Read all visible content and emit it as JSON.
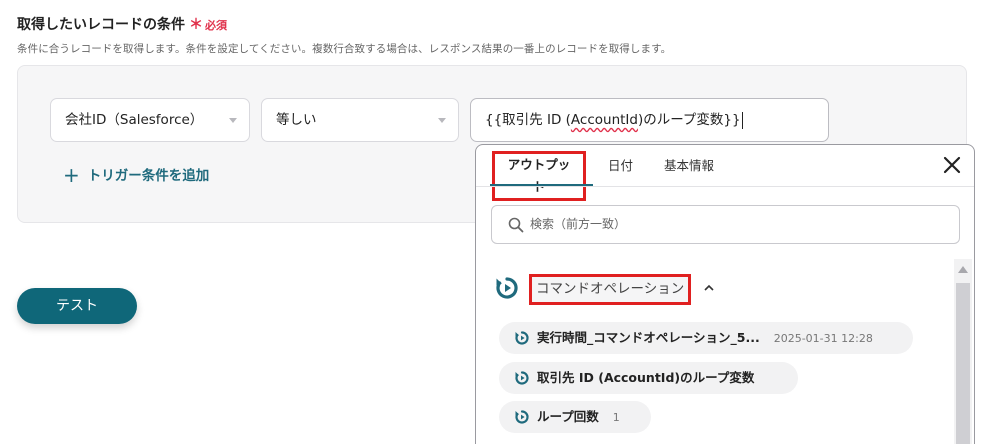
{
  "form": {
    "title": "取得したいレコードの条件",
    "required_mark": "＊",
    "required_text": "必須",
    "description": "条件に合うレコードを取得します。条件を設定してください。複数行合致する場合は、レスポンス結果の一番上のレコードを取得します。"
  },
  "condition": {
    "field_value": "会社ID（Salesforce）",
    "operator_value": "等しい",
    "value_prefix": "{{取引先 ID (",
    "value_wavy": "AccountId",
    "value_suffix": ")のループ変数}}"
  },
  "add_trigger_label": "トリガー条件を追加",
  "test_button_label": "テスト",
  "popup": {
    "tabs": [
      "アウトプット",
      "日付",
      "基本情報"
    ],
    "active_tab": "アウトプット",
    "search_placeholder": "検索（前方一致）",
    "group_label": "コマンドオペレーション",
    "items": [
      {
        "label": "実行時間_コマンドオペレーション_5...",
        "value": "2025-01-31 12:28"
      },
      {
        "label": "取引先 ID (AccountId)のループ変数",
        "value": ""
      },
      {
        "label": "ループ回数",
        "value": "1"
      }
    ]
  },
  "colors": {
    "accent": "#1f6a7d",
    "button": "#0f6779",
    "required": "#e0314b",
    "highlight_box": "#e02020"
  },
  "icons": {
    "group": "loop-refresh-icon",
    "item": "loop-refresh-icon",
    "close": "close-icon",
    "search": "search-icon"
  }
}
